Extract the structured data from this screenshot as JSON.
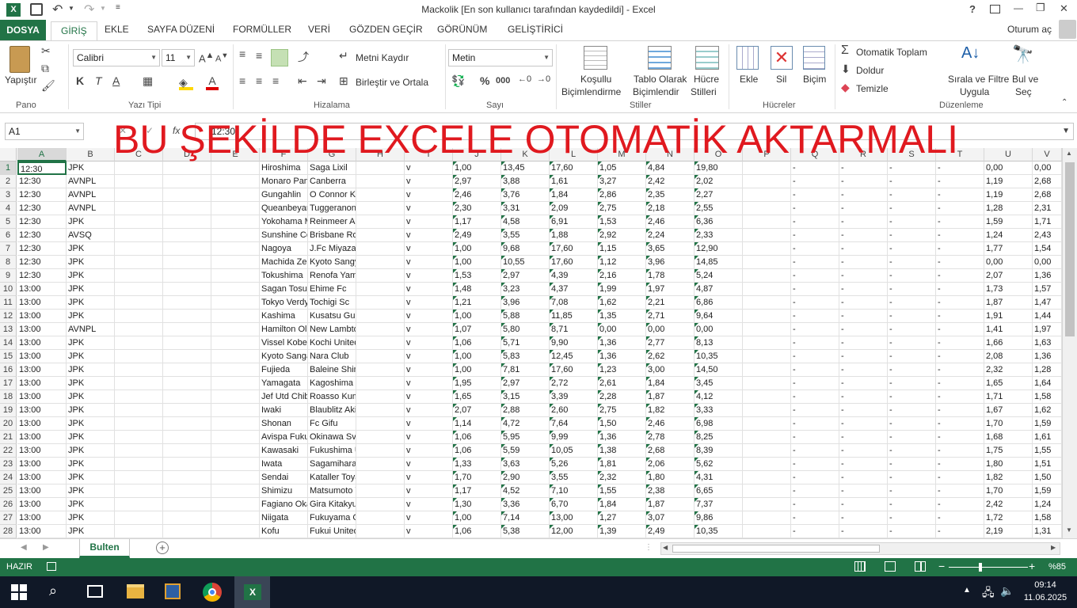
{
  "title_bar": {
    "title": "Mackolik [En son kullanıcı tarafından kaydedildi] - Excel",
    "app_icon": "excel-icon",
    "help": "?",
    "minimize": "—",
    "restore": "❐",
    "close": "✕"
  },
  "ribbon_tabs": {
    "file": "DOSYA",
    "tabs": [
      "GİRİŞ",
      "EKLE",
      "SAYFA DÜZENİ",
      "FORMÜLLER",
      "VERİ",
      "GÖZDEN GEÇİR",
      "GÖRÜNÜM",
      "GELİŞTİRİCİ"
    ],
    "user": "Oturum aç"
  },
  "ribbon": {
    "clipboard": {
      "paste": "Yapıştır",
      "label": "Pano"
    },
    "font": {
      "name": "Calibri",
      "size": "11",
      "bold": "K",
      "italic": "T",
      "underline": "A",
      "label": "Yazı Tipi"
    },
    "alignment": {
      "wrap": "Metni Kaydır",
      "merge": "Birleştir ve Ortala",
      "label": "Hizalama"
    },
    "number": {
      "format": "Metin",
      "percent": "%",
      "comma": "000",
      "label": "Sayı"
    },
    "styles": {
      "cond1": "Koşullu",
      "cond2": "Biçimlendirme",
      "table1": "Tablo Olarak",
      "table2": "Biçimlendir",
      "cell1": "Hücre",
      "cell2": "Stilleri",
      "label": "Stiller"
    },
    "cells": {
      "insert": "Ekle",
      "delete": "Sil",
      "format": "Biçim",
      "label": "Hücreler"
    },
    "editing": {
      "autosum": "Otomatik Toplam",
      "fill": "Doldur",
      "clear": "Temizle",
      "sort1": "Sırala ve Filtre",
      "sort2": "Uygula",
      "find1": "Bul ve",
      "find2": "Seç",
      "label": "Düzenleme"
    }
  },
  "formula_bar": {
    "name_box": "A1",
    "fx": "fx",
    "value": "12:30"
  },
  "overlay_text": "BU ŞEKİLDE EXCELE OTOMATİK AKTARMALI",
  "columns": [
    "A",
    "B",
    "C",
    "D",
    "E",
    "F",
    "G",
    "H",
    "I",
    "J",
    "K",
    "L",
    "M",
    "N",
    "O",
    "P",
    "Q",
    "R",
    "S",
    "T",
    "U",
    "V"
  ],
  "rows": [
    [
      "1",
      "12:30",
      "JPK",
      "Hiroshima",
      "Saga Lixil",
      "v",
      "1,00",
      "13,45",
      "17,60",
      "1,05",
      "4,84",
      "19,80",
      "-",
      "-",
      "-",
      "-",
      "0,00",
      "0,00"
    ],
    [
      "2",
      "12:30",
      "AVNPL",
      "Monaro Pan",
      "Canberra",
      "v",
      "2,97",
      "3,88",
      "1,61",
      "3,27",
      "2,42",
      "2,02",
      "-",
      "-",
      "-",
      "-",
      "1,19",
      "2,68"
    ],
    [
      "3",
      "12:30",
      "AVNPL",
      "Gungahlin",
      "O Connor Knight",
      "v",
      "2,46",
      "3,76",
      "1,84",
      "2,86",
      "2,35",
      "2,27",
      "-",
      "-",
      "-",
      "-",
      "1,19",
      "2,68"
    ],
    [
      "4",
      "12:30",
      "AVNPL",
      "Queanbeyan",
      "Tuggeranong Uni",
      "v",
      "2,30",
      "3,31",
      "2,09",
      "2,75",
      "2,18",
      "2,55",
      "-",
      "-",
      "-",
      "-",
      "1,28",
      "2,31"
    ],
    [
      "5",
      "12:30",
      "JPK",
      "Yokohama M",
      "Reinmeer Aomori",
      "v",
      "1,17",
      "4,58",
      "6,91",
      "1,53",
      "2,46",
      "6,36",
      "-",
      "-",
      "-",
      "-",
      "1,59",
      "1,71"
    ],
    [
      "6",
      "12:30",
      "AVSQ",
      "Sunshine Co",
      "Brisbane Roar I",
      "v",
      "2,49",
      "3,55",
      "1,88",
      "2,92",
      "2,24",
      "2,33",
      "-",
      "-",
      "-",
      "-",
      "1,24",
      "2,43"
    ],
    [
      "7",
      "12:30",
      "JPK",
      "Nagoya",
      "J.Fc Miyazaki",
      "v",
      "1,00",
      "9,68",
      "17,60",
      "1,15",
      "3,65",
      "12,90",
      "-",
      "-",
      "-",
      "-",
      "1,77",
      "1,54"
    ],
    [
      "8",
      "12:30",
      "JPK",
      "Machida Ze",
      "Kyoto Sangyo Un",
      "v",
      "1,00",
      "10,55",
      "17,60",
      "1,12",
      "3,96",
      "14,85",
      "-",
      "-",
      "-",
      "-",
      "0,00",
      "0,00"
    ],
    [
      "9",
      "12:30",
      "JPK",
      "Tokushima",
      "Renofa Yamaguch",
      "v",
      "1,53",
      "2,97",
      "4,39",
      "2,16",
      "1,78",
      "5,24",
      "-",
      "-",
      "-",
      "-",
      "2,07",
      "1,36"
    ],
    [
      "10",
      "13:00",
      "JPK",
      "Sagan Tosu",
      "Ehime Fc",
      "v",
      "1,48",
      "3,23",
      "4,37",
      "1,99",
      "1,97",
      "4,87",
      "-",
      "-",
      "-",
      "-",
      "1,73",
      "1,57"
    ],
    [
      "11",
      "13:00",
      "JPK",
      "Tokyo Verdy",
      "Tochigi Sc",
      "v",
      "1,21",
      "3,96",
      "7,08",
      "1,62",
      "2,21",
      "6,86",
      "-",
      "-",
      "-",
      "-",
      "1,87",
      "1,47"
    ],
    [
      "12",
      "13:00",
      "JPK",
      "Kashima",
      "Kusatsu Gunma",
      "v",
      "1,00",
      "5,88",
      "11,85",
      "1,35",
      "2,71",
      "9,64",
      "-",
      "-",
      "-",
      "-",
      "1,91",
      "1,44"
    ],
    [
      "13",
      "13:00",
      "AVNPL",
      "Hamilton Ol",
      "New Lambton Fc",
      "v",
      "1,07",
      "5,80",
      "8,71",
      "0,00",
      "0,00",
      "0,00",
      "-",
      "-",
      "-",
      "-",
      "1,41",
      "1,97"
    ],
    [
      "14",
      "13:00",
      "JPK",
      "Vissel Kobe",
      "Kochi United",
      "v",
      "1,06",
      "5,71",
      "9,90",
      "1,36",
      "2,77",
      "8,13",
      "-",
      "-",
      "-",
      "-",
      "1,66",
      "1,63"
    ],
    [
      "15",
      "13:00",
      "JPK",
      "Kyoto Sanga",
      "Nara Club",
      "v",
      "1,00",
      "5,83",
      "12,45",
      "1,36",
      "2,62",
      "10,35",
      "-",
      "-",
      "-",
      "-",
      "2,08",
      "1,36"
    ],
    [
      "16",
      "13:00",
      "JPK",
      "Fujieda",
      "Baleine Shimono",
      "v",
      "1,00",
      "7,81",
      "17,60",
      "1,23",
      "3,00",
      "14,50",
      "-",
      "-",
      "-",
      "-",
      "2,32",
      "1,28"
    ],
    [
      "17",
      "13:00",
      "JPK",
      "Yamagata",
      "Kagoshima Unite",
      "v",
      "1,95",
      "2,97",
      "2,72",
      "2,61",
      "1,84",
      "3,45",
      "-",
      "-",
      "-",
      "-",
      "1,65",
      "1,64"
    ],
    [
      "18",
      "13:00",
      "JPK",
      "Jef Utd Chib",
      "Roasso Kumamoto",
      "v",
      "1,65",
      "3,15",
      "3,39",
      "2,28",
      "1,87",
      "4,12",
      "-",
      "-",
      "-",
      "-",
      "1,71",
      "1,58"
    ],
    [
      "19",
      "13:00",
      "JPK",
      "Iwaki",
      "Blaublitz Akita",
      "v",
      "2,07",
      "2,88",
      "2,60",
      "2,75",
      "1,82",
      "3,33",
      "-",
      "-",
      "-",
      "-",
      "1,67",
      "1,62"
    ],
    [
      "20",
      "13:00",
      "JPK",
      "Shonan",
      "Fc Gifu",
      "v",
      "1,14",
      "4,72",
      "7,64",
      "1,50",
      "2,46",
      "6,98",
      "-",
      "-",
      "-",
      "-",
      "1,70",
      "1,59"
    ],
    [
      "21",
      "13:00",
      "JPK",
      "Avispa Fuku",
      "Okinawa Sv",
      "v",
      "1,06",
      "5,95",
      "9,99",
      "1,36",
      "2,78",
      "8,25",
      "-",
      "-",
      "-",
      "-",
      "1,68",
      "1,61"
    ],
    [
      "22",
      "13:00",
      "JPK",
      "Kawasaki",
      "Fukushima Unite",
      "v",
      "1,06",
      "5,59",
      "10,05",
      "1,38",
      "2,68",
      "8,39",
      "-",
      "-",
      "-",
      "-",
      "1,75",
      "1,55"
    ],
    [
      "23",
      "13:00",
      "JPK",
      "Iwata",
      "Sagamihara",
      "v",
      "1,33",
      "3,63",
      "5,26",
      "1,81",
      "2,06",
      "5,62",
      "-",
      "-",
      "-",
      "-",
      "1,80",
      "1,51"
    ],
    [
      "24",
      "13:00",
      "JPK",
      "Sendai",
      "Kataller Toyama",
      "v",
      "1,70",
      "2,90",
      "3,55",
      "2,32",
      "1,80",
      "4,31",
      "-",
      "-",
      "-",
      "-",
      "1,82",
      "1,50"
    ],
    [
      "25",
      "13:00",
      "JPK",
      "Shimizu",
      "Matsumoto Yamag",
      "v",
      "1,17",
      "4,52",
      "7,10",
      "1,55",
      "2,38",
      "6,65",
      "-",
      "-",
      "-",
      "-",
      "1,70",
      "1,59"
    ],
    [
      "26",
      "13:00",
      "JPK",
      "Fagiano Oka",
      "Gira Kitakyushu",
      "v",
      "1,30",
      "3,36",
      "6,70",
      "1,84",
      "1,87",
      "7,37",
      "-",
      "-",
      "-",
      "-",
      "2,42",
      "1,24"
    ],
    [
      "27",
      "13:00",
      "JPK",
      "Niigata",
      "Fukuyama City",
      "v",
      "1,00",
      "7,14",
      "13,00",
      "1,27",
      "3,07",
      "9,86",
      "-",
      "-",
      "-",
      "-",
      "1,72",
      "1,58"
    ],
    [
      "28",
      "13:00",
      "JPK",
      "Kofu",
      "Fukui United",
      "v",
      "1,06",
      "5,38",
      "12,00",
      "1,39",
      "2,49",
      "10,35",
      "-",
      "-",
      "-",
      "-",
      "2,19",
      "1,31"
    ]
  ],
  "sheet_tabs": {
    "active": "Bulten",
    "add": "+"
  },
  "status_bar": {
    "ready": "HAZIR",
    "zoom": "%85"
  },
  "taskbar": {
    "time": "09:14",
    "date": "11.06.2025"
  },
  "colors": {
    "excel_green": "#217346",
    "overlay_red": "#e0191f"
  }
}
